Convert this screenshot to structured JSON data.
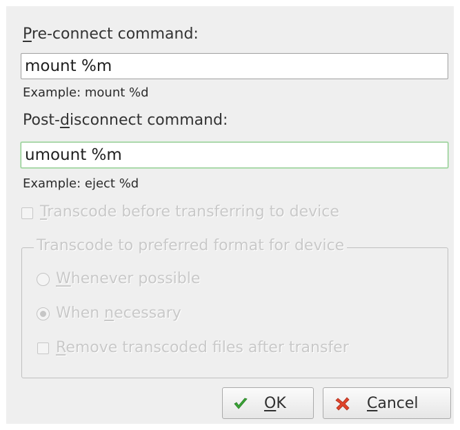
{
  "pre_connect": {
    "label_key": "P",
    "label_rest": "re-connect command:",
    "value": "mount %m",
    "example": "Example: mount %d"
  },
  "post_disconnect": {
    "label_before": "Post-",
    "label_key": "d",
    "label_after": "isconnect command:",
    "value": "umount %m",
    "example": "Example: eject %d"
  },
  "transcode_checkbox": {
    "label_key": "T",
    "label_rest": "ranscode before transferring to device",
    "checked": false,
    "enabled": false
  },
  "transcode_group": {
    "title": "Transcode to preferred format for device",
    "option_whenever": {
      "label_key": "W",
      "label_rest": "henever possible",
      "checked": false
    },
    "option_necessary": {
      "label_before": "When ",
      "label_key": "n",
      "label_after": "ecessary",
      "checked": true
    },
    "remove_files": {
      "label_key": "R",
      "label_rest": "emove transcoded files after transfer",
      "checked": false
    }
  },
  "buttons": {
    "ok": {
      "label_key": "O",
      "label_rest": "K",
      "icon": "checkmark-icon"
    },
    "cancel": {
      "label_key": "C",
      "label_rest": "ancel",
      "icon": "cancel-x-icon"
    }
  },
  "colors": {
    "ok_icon": "#3aa336",
    "cancel_icon": "#e0442b",
    "focus_border": "#8fc98f",
    "disabled_text": "#c9c9c9"
  }
}
